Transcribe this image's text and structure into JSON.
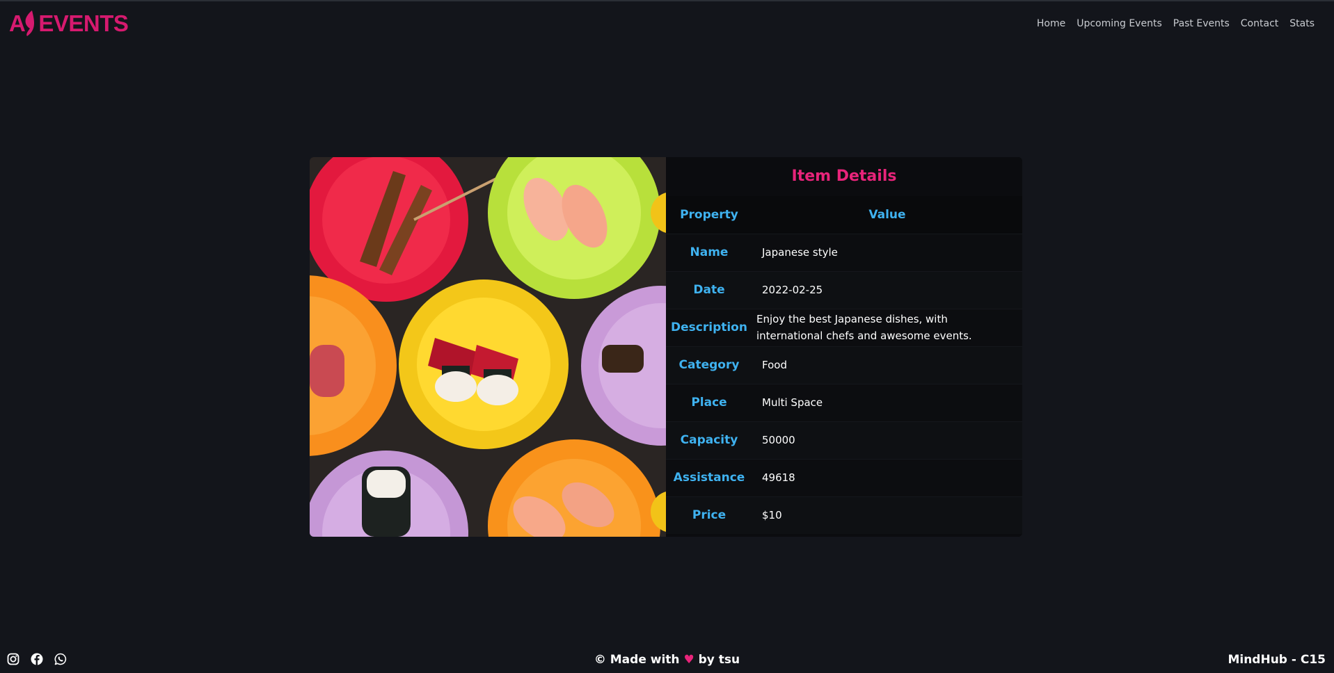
{
  "header": {
    "logo_text": "EVENTS",
    "nav": [
      "Home",
      "Upcoming Events",
      "Past Events",
      "Contact",
      "Stats"
    ]
  },
  "details": {
    "title": "Item Details",
    "col_property": "Property",
    "col_value": "Value",
    "rows": [
      {
        "property": "Name",
        "value": "Japanese style"
      },
      {
        "property": "Date",
        "value": "2022-02-25"
      },
      {
        "property": "Description",
        "value": "Enjoy the best Japanese dishes, with international chefs and awesome events."
      },
      {
        "property": "Category",
        "value": "Food"
      },
      {
        "property": "Place",
        "value": "Multi Space"
      },
      {
        "property": "Capacity",
        "value": "50000"
      },
      {
        "property": "Assistance",
        "value": "49618"
      },
      {
        "property": "Price",
        "value": "$10"
      }
    ]
  },
  "footer": {
    "made_prefix": "© Made with",
    "heart": "♥",
    "made_suffix": "by tsu",
    "brand": "MindHub - C15",
    "social_icons": [
      "instagram-icon",
      "facebook-icon",
      "whatsapp-icon"
    ]
  },
  "colors": {
    "background": "#13151b",
    "accent_pink": "#e8247a",
    "accent_blue": "#3fb2f0"
  }
}
